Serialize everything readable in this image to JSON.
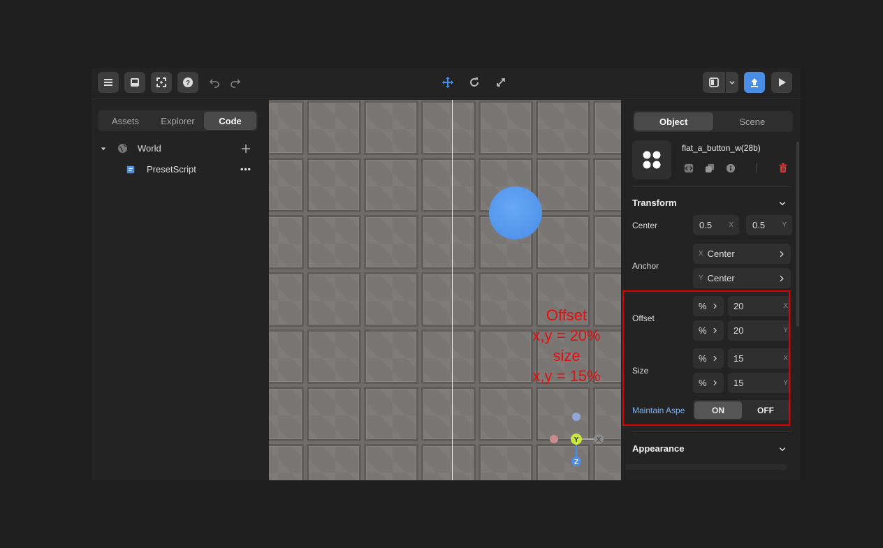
{
  "left_panel": {
    "tabs": [
      "Assets",
      "Explorer",
      "Code"
    ],
    "active_tab": "Code",
    "tree": {
      "world_label": "World",
      "script_label": "PresetScript"
    }
  },
  "right_panel": {
    "tabs": [
      "Object",
      "Scene"
    ],
    "active_tab": "Object",
    "object_name": "flat_a_button_w(28b)",
    "transform": {
      "title": "Transform",
      "center_label": "Center",
      "center_x": "0.5",
      "center_y": "0.5",
      "anchor_label": "Anchor",
      "anchor_x": "Center",
      "anchor_y": "Center",
      "offset_label": "Offset",
      "offset_unit_x": "%",
      "offset_unit_y": "%",
      "offset_x": "20",
      "offset_y": "20",
      "size_label": "Size",
      "size_unit_x": "%",
      "size_unit_y": "%",
      "size_x": "15",
      "size_y": "15",
      "maintain_label": "Maintain Aspe",
      "toggle_on": "ON",
      "toggle_off": "OFF"
    },
    "appearance_title": "Appearance",
    "axis_x": "X",
    "axis_y": "Y"
  },
  "viewport": {
    "annotation": [
      "Offset",
      "x,y = 20%",
      "size",
      "x,y = 15%"
    ],
    "gizmo": {
      "y": "Y",
      "x": "X",
      "z": "Z"
    }
  },
  "colors": {
    "accent": "#4a8de6",
    "annotation": "#e01010",
    "delete": "#d94040"
  }
}
